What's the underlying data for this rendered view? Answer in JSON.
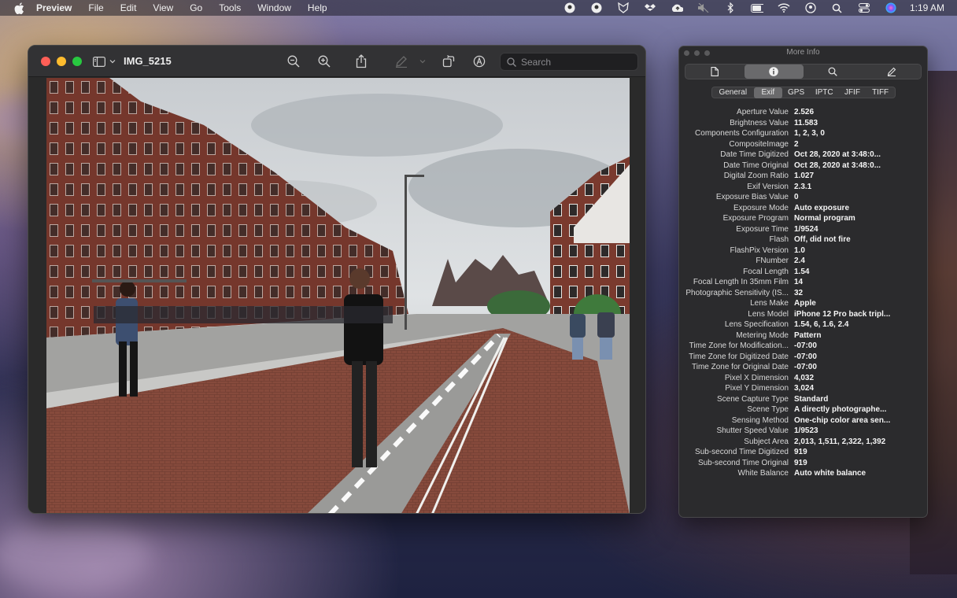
{
  "menubar": {
    "app_name": "Preview",
    "items": [
      "File",
      "Edit",
      "View",
      "Go",
      "Tools",
      "Window",
      "Help"
    ],
    "clock": "1:19 AM",
    "status_icons": [
      "account-icon-1",
      "account-icon-2",
      "fox-icon",
      "dropbox-icon",
      "cloud-upload-icon",
      "mute-icon",
      "bluetooth-icon",
      "battery-icon",
      "wifi-icon",
      "user-icon",
      "search-icon",
      "control-center-icon",
      "siri-icon"
    ]
  },
  "preview_window": {
    "title": "IMG_5215",
    "search_placeholder": "Search",
    "toolbar_icons": [
      "sidebar-icon",
      "zoom-out-icon",
      "zoom-in-icon",
      "share-icon",
      "markup-icon",
      "rotate-icon",
      "annotate-icon"
    ]
  },
  "info_panel": {
    "title": "More Info",
    "toolbar_icons": [
      "document-icon",
      "info-icon",
      "search-icon",
      "pencil-icon"
    ],
    "active_toolbar_index": 1,
    "tabs": [
      "General",
      "Exif",
      "GPS",
      "IPTC",
      "JFIF",
      "TIFF"
    ],
    "active_tab": "Exif",
    "rows": [
      {
        "k": "Aperture Value",
        "v": "2.526"
      },
      {
        "k": "Brightness Value",
        "v": "11.583"
      },
      {
        "k": "Components Configuration",
        "v": "1, 2, 3, 0"
      },
      {
        "k": "CompositeImage",
        "v": "2"
      },
      {
        "k": "Date Time Digitized",
        "v": "Oct 28, 2020 at 3:48:0..."
      },
      {
        "k": "Date Time Original",
        "v": "Oct 28, 2020 at 3:48:0..."
      },
      {
        "k": "Digital Zoom Ratio",
        "v": "1.027"
      },
      {
        "k": "Exif Version",
        "v": "2.3.1"
      },
      {
        "k": "Exposure Bias Value",
        "v": "0"
      },
      {
        "k": "Exposure Mode",
        "v": "Auto exposure"
      },
      {
        "k": "Exposure Program",
        "v": "Normal program"
      },
      {
        "k": "Exposure Time",
        "v": "1/9524"
      },
      {
        "k": "Flash",
        "v": "Off, did not fire"
      },
      {
        "k": "FlashPix Version",
        "v": "1.0"
      },
      {
        "k": "FNumber",
        "v": "2.4"
      },
      {
        "k": "Focal Length",
        "v": "1.54"
      },
      {
        "k": "Focal Length In 35mm Film",
        "v": "14"
      },
      {
        "k": "Photographic Sensitivity (IS...",
        "v": "32"
      },
      {
        "k": "Lens Make",
        "v": "Apple"
      },
      {
        "k": "Lens Model",
        "v": "iPhone 12 Pro back tripl..."
      },
      {
        "k": "Lens Specification",
        "v": "1.54, 6, 1.6, 2.4"
      },
      {
        "k": "Metering Mode",
        "v": "Pattern"
      },
      {
        "k": "Time Zone for Modification...",
        "v": "-07:00"
      },
      {
        "k": "Time Zone for Digitized Date",
        "v": "-07:00"
      },
      {
        "k": "Time Zone for Original Date",
        "v": "-07:00"
      },
      {
        "k": "Pixel X Dimension",
        "v": "4,032"
      },
      {
        "k": "Pixel Y Dimension",
        "v": "3,024"
      },
      {
        "k": "Scene Capture Type",
        "v": "Standard"
      },
      {
        "k": "Scene Type",
        "v": "A directly photographe..."
      },
      {
        "k": "Sensing Method",
        "v": "One-chip color area sen..."
      },
      {
        "k": "Shutter Speed Value",
        "v": "1/9523"
      },
      {
        "k": "Subject Area",
        "v": "2,013, 1,511, 2,322, 1,392"
      },
      {
        "k": "Sub-second Time Digitized",
        "v": "919"
      },
      {
        "k": "Sub-second Time Original",
        "v": "919"
      },
      {
        "k": "White Balance",
        "v": "Auto white balance"
      }
    ]
  }
}
